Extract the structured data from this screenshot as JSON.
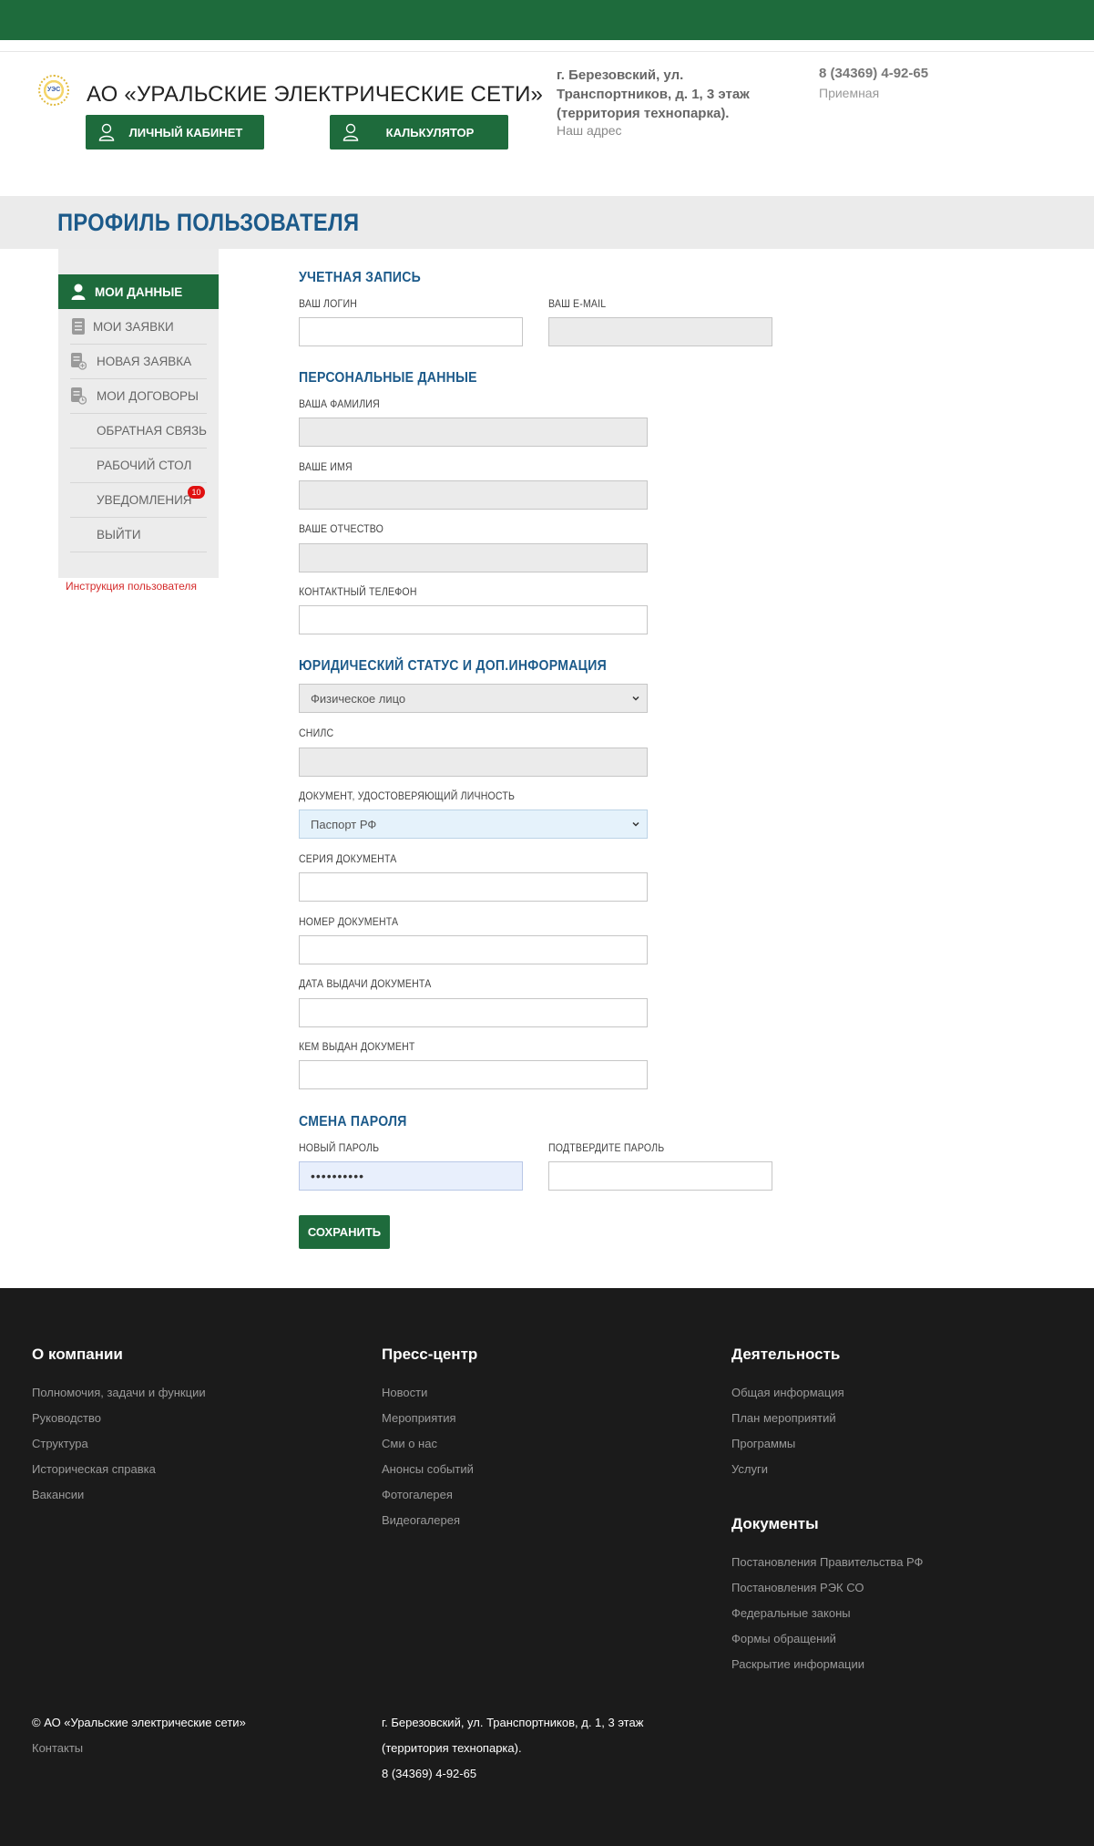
{
  "header": {
    "company": "АО «УРАЛЬСКИЕ ЭЛЕКТРИЧЕСКИЕ СЕТИ»",
    "logo_text": "УЭС",
    "cabinet_label": "ЛИЧНЫЙ КАБИНЕТ",
    "calc_label": "КАЛЬКУЛЯТОР",
    "address": "г. Березовский, ул. Транспортников, д. 1, 3 этаж (территория технопарка).",
    "address_caption": "Наш адрес",
    "phone": "8 (34369) 4-92-65",
    "phone_caption": "Приемная"
  },
  "page_title": "ПРОФИЛЬ ПОЛЬЗОВАТЕЛЯ",
  "sidebar": {
    "items": [
      {
        "label": "МОИ ДАННЫЕ",
        "icon": "user-icon"
      },
      {
        "label": "МОИ ЗАЯВКИ",
        "icon": "document-icon"
      },
      {
        "label": "НОВАЯ ЗАЯВКА",
        "icon": "new-document-icon"
      },
      {
        "label": "МОИ ДОГОВОРЫ",
        "icon": "contract-icon"
      },
      {
        "label": "ОБРАТНАЯ СВЯЗЬ"
      },
      {
        "label": "РАБОЧИЙ СТОЛ"
      },
      {
        "label": "УВЕДОМЛЕНИЯ"
      },
      {
        "label": "ВЫЙТИ"
      }
    ],
    "notifications_count": "10",
    "instruction_link": "Инструкция пользователя"
  },
  "form": {
    "account_title": "УЧЕТНАЯ ЗАПИСЬ",
    "login_label": "ВАШ ЛОГИН",
    "login_value": "",
    "email_label": "ВАШ E-MAIL",
    "email_value": "",
    "personal_title": "ПЕРСОНАЛЬНЫЕ ДАННЫЕ",
    "surname_label": "ВАША ФАМИЛИЯ",
    "name_label": "ВАШЕ ИМЯ",
    "patronymic_label": "ВАШЕ ОТЧЕСТВО",
    "phone_label": "КОНТАКТНЫЙ ТЕЛЕФОН",
    "legal_title": "ЮРИДИЧЕСКИЙ СТАТУС И ДОП.ИНФОРМАЦИЯ",
    "legal_status_value": "Физическое лицо",
    "snils_label": "СНИЛС",
    "doc_label": "ДОКУМЕНТ, УДОСТОВЕРЯЮЩИЙ ЛИЧНОСТЬ",
    "doc_value": "Паспорт РФ",
    "series_label": "СЕРИЯ ДОКУМЕНТА",
    "number_label": "НОМЕР ДОКУМЕНТА",
    "issue_date_label": "ДАТА ВЫДАЧИ ДОКУМЕНТА",
    "issued_by_label": "КЕМ ВЫДАН ДОКУМЕНТ",
    "password_title": "СМЕНА ПАРОЛЯ",
    "new_password_label": "НОВЫЙ ПАРОЛЬ",
    "new_password_value": "••••••••••",
    "confirm_password_label": "ПОДТВЕРДИТЕ ПАРОЛЬ",
    "save_label": "СОХРАНИТЬ"
  },
  "footer": {
    "col1_title": "О компании",
    "col1_links": [
      "Полномочия, задачи и функции",
      "Руководство",
      "Структура",
      "Историческая справка",
      "Вакансии"
    ],
    "col2_title": "Пресс-центр",
    "col2_links": [
      "Новости",
      "Мероприятия",
      "Сми о нас",
      "Анонсы событий",
      "Фотогалерея",
      "Видеогалерея"
    ],
    "col3_title": "Деятельность",
    "col3_links": [
      "Общая информация",
      "План мероприятий",
      "Программы",
      "Услуги"
    ],
    "col4_title": "Документы",
    "col4_links": [
      "Постановления Правительства РФ",
      "Постановления РЭК СО",
      "Федеральные законы",
      "Формы обращений",
      "Раскрытие информации"
    ],
    "copyright": "© АО «Уральские электрические сети»",
    "contacts": "Контакты",
    "address_line1": "г. Березовский, ул. Транспортников, д. 1, 3 этаж",
    "address_line2": "(территория технопарка).",
    "phone": "8 (34369) 4-92-65"
  },
  "colors": {
    "brand_green": "#1e6b3c",
    "title_blue": "#1c5a8a",
    "footer_bg": "#1b1b1b",
    "badge_red": "#e01010"
  }
}
